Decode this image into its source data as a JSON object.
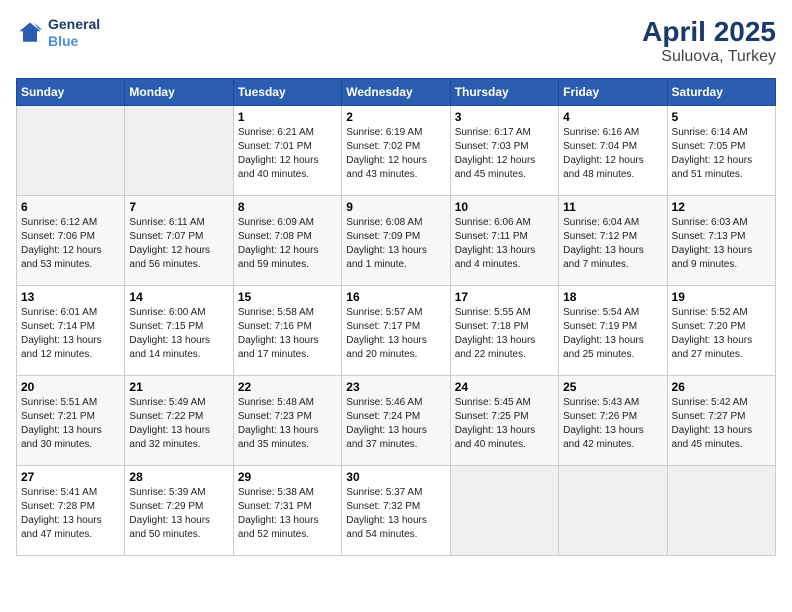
{
  "logo": {
    "line1": "General",
    "line2": "Blue"
  },
  "title": "April 2025",
  "subtitle": "Suluova, Turkey",
  "days_of_week": [
    "Sunday",
    "Monday",
    "Tuesday",
    "Wednesday",
    "Thursday",
    "Friday",
    "Saturday"
  ],
  "weeks": [
    [
      {
        "day": "",
        "detail": ""
      },
      {
        "day": "",
        "detail": ""
      },
      {
        "day": "1",
        "detail": "Sunrise: 6:21 AM\nSunset: 7:01 PM\nDaylight: 12 hours and 40 minutes."
      },
      {
        "day": "2",
        "detail": "Sunrise: 6:19 AM\nSunset: 7:02 PM\nDaylight: 12 hours and 43 minutes."
      },
      {
        "day": "3",
        "detail": "Sunrise: 6:17 AM\nSunset: 7:03 PM\nDaylight: 12 hours and 45 minutes."
      },
      {
        "day": "4",
        "detail": "Sunrise: 6:16 AM\nSunset: 7:04 PM\nDaylight: 12 hours and 48 minutes."
      },
      {
        "day": "5",
        "detail": "Sunrise: 6:14 AM\nSunset: 7:05 PM\nDaylight: 12 hours and 51 minutes."
      }
    ],
    [
      {
        "day": "6",
        "detail": "Sunrise: 6:12 AM\nSunset: 7:06 PM\nDaylight: 12 hours and 53 minutes."
      },
      {
        "day": "7",
        "detail": "Sunrise: 6:11 AM\nSunset: 7:07 PM\nDaylight: 12 hours and 56 minutes."
      },
      {
        "day": "8",
        "detail": "Sunrise: 6:09 AM\nSunset: 7:08 PM\nDaylight: 12 hours and 59 minutes."
      },
      {
        "day": "9",
        "detail": "Sunrise: 6:08 AM\nSunset: 7:09 PM\nDaylight: 13 hours and 1 minute."
      },
      {
        "day": "10",
        "detail": "Sunrise: 6:06 AM\nSunset: 7:11 PM\nDaylight: 13 hours and 4 minutes."
      },
      {
        "day": "11",
        "detail": "Sunrise: 6:04 AM\nSunset: 7:12 PM\nDaylight: 13 hours and 7 minutes."
      },
      {
        "day": "12",
        "detail": "Sunrise: 6:03 AM\nSunset: 7:13 PM\nDaylight: 13 hours and 9 minutes."
      }
    ],
    [
      {
        "day": "13",
        "detail": "Sunrise: 6:01 AM\nSunset: 7:14 PM\nDaylight: 13 hours and 12 minutes."
      },
      {
        "day": "14",
        "detail": "Sunrise: 6:00 AM\nSunset: 7:15 PM\nDaylight: 13 hours and 14 minutes."
      },
      {
        "day": "15",
        "detail": "Sunrise: 5:58 AM\nSunset: 7:16 PM\nDaylight: 13 hours and 17 minutes."
      },
      {
        "day": "16",
        "detail": "Sunrise: 5:57 AM\nSunset: 7:17 PM\nDaylight: 13 hours and 20 minutes."
      },
      {
        "day": "17",
        "detail": "Sunrise: 5:55 AM\nSunset: 7:18 PM\nDaylight: 13 hours and 22 minutes."
      },
      {
        "day": "18",
        "detail": "Sunrise: 5:54 AM\nSunset: 7:19 PM\nDaylight: 13 hours and 25 minutes."
      },
      {
        "day": "19",
        "detail": "Sunrise: 5:52 AM\nSunset: 7:20 PM\nDaylight: 13 hours and 27 minutes."
      }
    ],
    [
      {
        "day": "20",
        "detail": "Sunrise: 5:51 AM\nSunset: 7:21 PM\nDaylight: 13 hours and 30 minutes."
      },
      {
        "day": "21",
        "detail": "Sunrise: 5:49 AM\nSunset: 7:22 PM\nDaylight: 13 hours and 32 minutes."
      },
      {
        "day": "22",
        "detail": "Sunrise: 5:48 AM\nSunset: 7:23 PM\nDaylight: 13 hours and 35 minutes."
      },
      {
        "day": "23",
        "detail": "Sunrise: 5:46 AM\nSunset: 7:24 PM\nDaylight: 13 hours and 37 minutes."
      },
      {
        "day": "24",
        "detail": "Sunrise: 5:45 AM\nSunset: 7:25 PM\nDaylight: 13 hours and 40 minutes."
      },
      {
        "day": "25",
        "detail": "Sunrise: 5:43 AM\nSunset: 7:26 PM\nDaylight: 13 hours and 42 minutes."
      },
      {
        "day": "26",
        "detail": "Sunrise: 5:42 AM\nSunset: 7:27 PM\nDaylight: 13 hours and 45 minutes."
      }
    ],
    [
      {
        "day": "27",
        "detail": "Sunrise: 5:41 AM\nSunset: 7:28 PM\nDaylight: 13 hours and 47 minutes."
      },
      {
        "day": "28",
        "detail": "Sunrise: 5:39 AM\nSunset: 7:29 PM\nDaylight: 13 hours and 50 minutes."
      },
      {
        "day": "29",
        "detail": "Sunrise: 5:38 AM\nSunset: 7:31 PM\nDaylight: 13 hours and 52 minutes."
      },
      {
        "day": "30",
        "detail": "Sunrise: 5:37 AM\nSunset: 7:32 PM\nDaylight: 13 hours and 54 minutes."
      },
      {
        "day": "",
        "detail": ""
      },
      {
        "day": "",
        "detail": ""
      },
      {
        "day": "",
        "detail": ""
      }
    ]
  ]
}
